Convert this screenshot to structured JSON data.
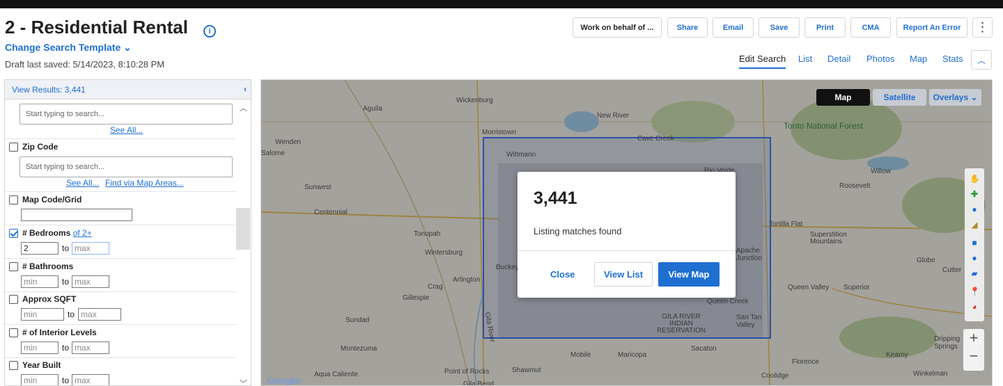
{
  "header": {
    "title": "2 - Residential Rental",
    "change_template": "Change Search Template",
    "draft_saved": "Draft last saved: 5/14/2023, 8:10:28 PM"
  },
  "toolbar": {
    "work_on_behalf": "Work on behalf of ...",
    "share": "Share",
    "email": "Email",
    "save": "Save",
    "print": "Print",
    "cma": "CMA",
    "report_error": "Report An Error"
  },
  "tabs": [
    "Edit Search",
    "List",
    "Detail",
    "Photos",
    "Map",
    "Stats"
  ],
  "sidebar": {
    "view_results": "View Results: 3,441",
    "search_placeholder_1": "Start typing to search...",
    "see_all_1": "See All...",
    "zip_code": "Zip Code",
    "search_placeholder_2": "Start typing to search...",
    "see_all_2": "See All...",
    "find_via_map": "Find via Map Areas...",
    "map_code": "Map Code/Grid",
    "bedrooms": "# Bedrooms",
    "bedrooms_of": "of 2+",
    "bedrooms_min": "2",
    "bathrooms": "# Bathrooms",
    "sqft": "Approx SQFT",
    "interior_levels": "# of Interior Levels",
    "year_built": "Year Built",
    "min_ph": "min",
    "max_ph": "max",
    "to": "to"
  },
  "map": {
    "type_map": "Map",
    "type_satellite": "Satellite",
    "overlays": "Overlays",
    "google": "Google",
    "places": [
      "Aguila",
      "Wickenburg",
      "New River",
      "Morristown",
      "Cave Creek",
      "Wenden",
      "Salome",
      "Wittmann",
      "Rio Verde",
      "Sunwest",
      "Centennial",
      "Tonopah",
      "Wintersburg",
      "Buckeye",
      "Arlington",
      "Crag",
      "Gillespie",
      "Sundad",
      "Montezuma",
      "Mobile",
      "Maricopa",
      "Aqua Caliente",
      "Point of Rocks",
      "Shawmut",
      "Gila Bend",
      "Tonto National Forest",
      "Willow",
      "Roosevelt",
      "Tortilla Flat",
      "Superstition Mountains",
      "Apache Junction",
      "Globe",
      "Queen Valley",
      "Superior",
      "Queen Creek",
      "San Tan Valley",
      "GILA RIVER INDIAN RESERVATION",
      "Sacaton",
      "Florence",
      "Coolidge",
      "Kearny",
      "Dripping Springs",
      "Winkelman",
      "Gila River",
      "Cutter"
    ]
  },
  "dialog": {
    "count": "3,441",
    "message": "Listing matches found",
    "close": "Close",
    "view_list": "View List",
    "view_map": "View Map"
  }
}
